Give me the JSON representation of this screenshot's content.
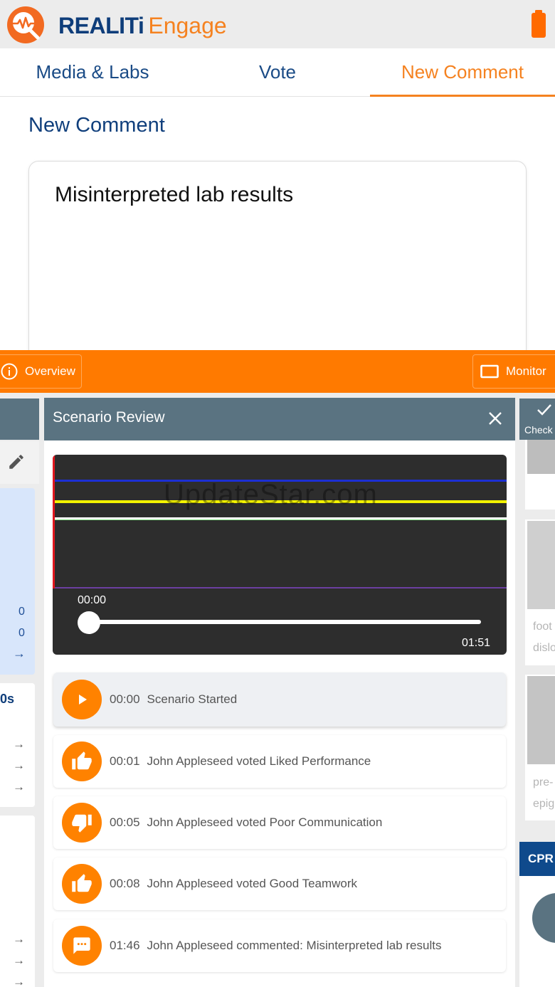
{
  "app": {
    "brand_main": "REALITi",
    "brand_sub": "Engage"
  },
  "tabs": [
    {
      "label": "Media & Labs"
    },
    {
      "label": "Vote"
    },
    {
      "label": "New Comment"
    }
  ],
  "new_comment": {
    "title": "New Comment",
    "text": "Misinterpreted lab results"
  },
  "toolbar": {
    "overview_label": "Overview",
    "monitor_label": "Monitor"
  },
  "left_panel": {
    "values": [
      "0",
      "0"
    ],
    "duration_label": "0s"
  },
  "right_panel": {
    "check_label": "Check",
    "card1_lines": [
      "foot",
      "dislo"
    ],
    "card2_lines": [
      "pre-",
      "epig"
    ],
    "cpr_label": "CPR"
  },
  "scenario_review": {
    "title": "Scenario Review",
    "watermark": "UpdateStar.com",
    "current_time": "00:00",
    "duration": "01:51",
    "progress": 0.0,
    "events": [
      {
        "time": "00:00",
        "text": "Scenario Started",
        "icon": "play-icon"
      },
      {
        "time": "00:01",
        "text": "John Appleseed voted Liked Performance",
        "icon": "thumbs-up-icon"
      },
      {
        "time": "00:05",
        "text": "John Appleseed voted Poor Communication",
        "icon": "thumbs-down-icon"
      },
      {
        "time": "00:08",
        "text": "John Appleseed voted Good Teamwork",
        "icon": "thumbs-up-icon"
      },
      {
        "time": "01:46",
        "text": "John Appleseed commented: Misinterpreted lab results",
        "icon": "comment-icon"
      }
    ]
  },
  "colors": {
    "accent": "#ff7a00",
    "brand_blue": "#0e3d7a",
    "header_slate": "#5a7381"
  }
}
